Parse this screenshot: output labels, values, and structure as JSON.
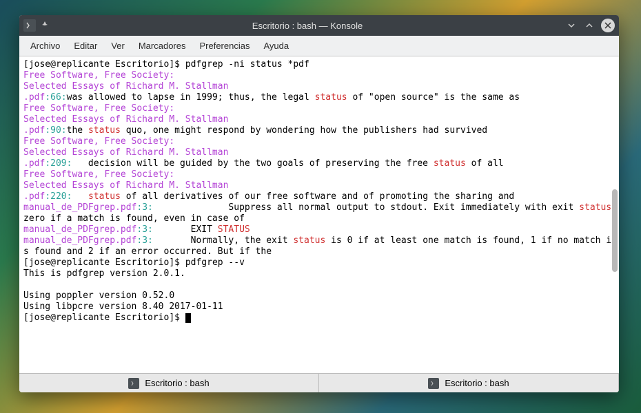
{
  "window": {
    "title": "Escritorio : bash — Konsole"
  },
  "menubar": {
    "items": [
      "Archivo",
      "Editar",
      "Ver",
      "Marcadores",
      "Preferencias",
      "Ayuda"
    ]
  },
  "terminal": {
    "prompt1": "[jose@replicante Escritorio]$ ",
    "cmd1": "pdfgrep -ni status *pdf",
    "title_line": "Free Software, Free Society:",
    "subtitle_line": "Selected Essays of Richard M. Stallman",
    "r1_file": ".pdf",
    "r1_ln": "66",
    "r1_pre": "was allowed to lapse in 1999; thus, the legal ",
    "r1_match": "status",
    "r1_post": " of \"open source\" is the same as",
    "r2_file": ".pdf",
    "r2_ln": "90",
    "r2_pre": "the ",
    "r2_match": "status",
    "r2_post": " quo, one might respond by wondering how the publishers had survived",
    "r3_file": ".pdf",
    "r3_ln": "209",
    "r3_pre": "   decision will be guided by the two goals of preserving the free ",
    "r3_match": "status",
    "r3_post": " of all",
    "r4_file": ".pdf",
    "r4_ln": "220",
    "r4_pre": "   ",
    "r4_match": "status",
    "r4_post": " of all derivatives of our free software and of promoting the sharing and",
    "m1_file": "manual_de_PDFgrep.pdf",
    "m1_ln": "3",
    "m1_pre": "              Suppress all normal output to stdout. Exit immediately with exit ",
    "m1_match": "status",
    "m1_post": " zero if a match is found, even in case of",
    "m2_file": "manual_de_PDFgrep.pdf",
    "m2_ln": "3",
    "m2_pre": "       EXIT ",
    "m2_match": "STATUS",
    "m3_file": "manual_de_PDFgrep.pdf",
    "m3_ln": "3",
    "m3_pre": "       Normally, the exit ",
    "m3_match": "status",
    "m3_post": " is 0 if at least one match is found, 1 if no match is found and 2 if an error occurred. But if the",
    "prompt2": "[jose@replicante Escritorio]$ ",
    "cmd2": "pdfgrep --v",
    "ver1": "This is pdfgrep version 2.0.1.",
    "ver2": "Using poppler version 0.52.0",
    "ver3": "Using libpcre version 8.40 2017-01-11",
    "prompt3": "[jose@replicante Escritorio]$ "
  },
  "tabs": {
    "t1": "Escritorio : bash",
    "t2": "Escritorio : bash"
  }
}
